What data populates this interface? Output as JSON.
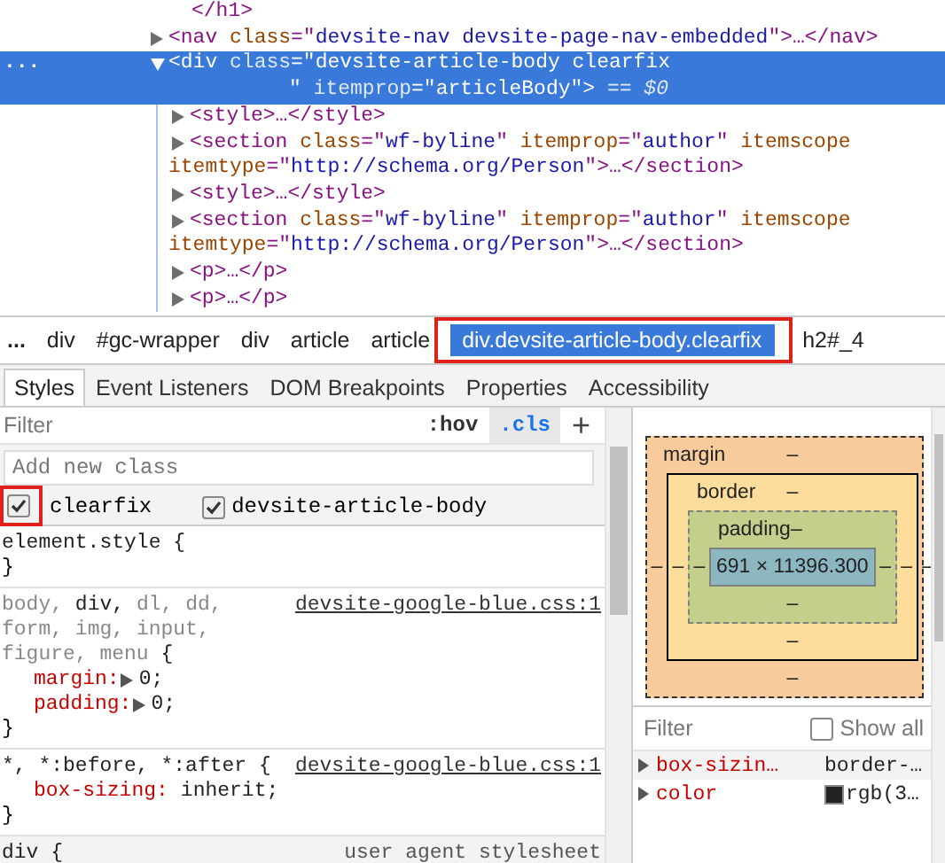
{
  "dom": {
    "nodes": [
      {
        "kind": "close",
        "lines": [
          [
            {
              "kind": "tag",
              "text": "</h1>"
            }
          ]
        ]
      },
      {
        "kind": "element",
        "expanded": false,
        "selected": false,
        "lines": [
          [
            {
              "kind": "tag",
              "text": "<nav"
            },
            {
              "kind": "attr",
              "text": " class"
            },
            {
              "kind": "tag",
              "text": "=\""
            },
            {
              "kind": "value",
              "text": "devsite-nav devsite-page-nav-embedded"
            },
            {
              "kind": "tag",
              "text": "\">…</nav>"
            }
          ]
        ]
      },
      {
        "kind": "element",
        "expanded": true,
        "selected": true,
        "gutter": "...",
        "lines": [
          [
            {
              "kind": "tag",
              "text": "<div"
            },
            {
              "kind": "attr",
              "text": " class"
            },
            {
              "kind": "tag",
              "text": "=\""
            },
            {
              "kind": "value",
              "text": "devsite-article-body clearfix"
            }
          ],
          [
            {
              "kind": "tag",
              "text": "\""
            },
            {
              "kind": "attr",
              "text": " itemprop"
            },
            {
              "kind": "tag",
              "text": "=\""
            },
            {
              "kind": "value",
              "text": "articleBody"
            },
            {
              "kind": "tag",
              "text": "\">"
            },
            {
              "kind": "ref",
              "text": " == $0"
            }
          ]
        ],
        "children": [
          {
            "kind": "element",
            "expanded": false,
            "selected": false,
            "lines": [
              [
                {
                  "kind": "tag",
                  "text": "<style>…</style>"
                }
              ]
            ]
          },
          {
            "kind": "element",
            "expanded": false,
            "selected": false,
            "lines": [
              [
                {
                  "kind": "tag",
                  "text": "<section"
                },
                {
                  "kind": "attr",
                  "text": " class"
                },
                {
                  "kind": "tag",
                  "text": "=\""
                },
                {
                  "kind": "value",
                  "text": "wf-byline"
                },
                {
                  "kind": "tag",
                  "text": "\""
                },
                {
                  "kind": "attr",
                  "text": " itemprop"
                },
                {
                  "kind": "tag",
                  "text": "=\""
                },
                {
                  "kind": "value",
                  "text": "author"
                },
                {
                  "kind": "tag",
                  "text": "\""
                },
                {
                  "kind": "attr",
                  "text": " itemscope"
                }
              ],
              [
                {
                  "kind": "attr",
                  "text": "itemtype"
                },
                {
                  "kind": "tag",
                  "text": "=\""
                },
                {
                  "kind": "value",
                  "text": "http://schema.org/Person"
                },
                {
                  "kind": "tag",
                  "text": "\">…</section>"
                }
              ]
            ]
          },
          {
            "kind": "element",
            "expanded": false,
            "selected": false,
            "lines": [
              [
                {
                  "kind": "tag",
                  "text": "<style>…</style>"
                }
              ]
            ]
          },
          {
            "kind": "element",
            "expanded": false,
            "selected": false,
            "lines": [
              [
                {
                  "kind": "tag",
                  "text": "<section"
                },
                {
                  "kind": "attr",
                  "text": " class"
                },
                {
                  "kind": "tag",
                  "text": "=\""
                },
                {
                  "kind": "value",
                  "text": "wf-byline"
                },
                {
                  "kind": "tag",
                  "text": "\""
                },
                {
                  "kind": "attr",
                  "text": " itemprop"
                },
                {
                  "kind": "tag",
                  "text": "=\""
                },
                {
                  "kind": "value",
                  "text": "author"
                },
                {
                  "kind": "tag",
                  "text": "\""
                },
                {
                  "kind": "attr",
                  "text": " itemscope"
                }
              ],
              [
                {
                  "kind": "attr",
                  "text": "itemtype"
                },
                {
                  "kind": "tag",
                  "text": "=\""
                },
                {
                  "kind": "value",
                  "text": "http://schema.org/Person"
                },
                {
                  "kind": "tag",
                  "text": "\">…</section>"
                }
              ]
            ]
          },
          {
            "kind": "element",
            "expanded": false,
            "selected": false,
            "lines": [
              [
                {
                  "kind": "tag",
                  "text": "<p>…</p>"
                }
              ]
            ]
          },
          {
            "kind": "element",
            "expanded": false,
            "selected": false,
            "lines": [
              [
                {
                  "kind": "tag",
                  "text": "<p>…</p>"
                }
              ]
            ]
          }
        ]
      }
    ]
  },
  "breadcrumbs": [
    {
      "text": "...",
      "kind": "more",
      "selected": false,
      "highlighted": false
    },
    {
      "text": "div",
      "kind": "crumb",
      "selected": false,
      "highlighted": false
    },
    {
      "text": "#gc-wrapper",
      "kind": "crumb",
      "selected": false,
      "highlighted": false
    },
    {
      "text": "div",
      "kind": "crumb",
      "selected": false,
      "highlighted": false
    },
    {
      "text": "article",
      "kind": "crumb",
      "selected": false,
      "highlighted": false
    },
    {
      "text": "article",
      "kind": "crumb",
      "selected": false,
      "highlighted": false
    },
    {
      "text": "div.devsite-article-body.clearfix",
      "kind": "crumb",
      "selected": true,
      "highlighted": true
    },
    {
      "text": "h2#_4",
      "kind": "crumb",
      "selected": false,
      "highlighted": false
    }
  ],
  "tabs": [
    {
      "label": "Styles",
      "selected": true
    },
    {
      "label": "Event Listeners",
      "selected": false
    },
    {
      "label": "DOM Breakpoints",
      "selected": false
    },
    {
      "label": "Properties",
      "selected": false
    },
    {
      "label": "Accessibility",
      "selected": false
    }
  ],
  "styles": {
    "filter": {
      "placeholder": "Filter"
    },
    "hov": {
      "text": ":hov",
      "on": false
    },
    "cls": {
      "text": ".cls",
      "on": true
    },
    "add": "+",
    "add_class": {
      "placeholder": "Add new class"
    },
    "classes": [
      {
        "name": "clearfix",
        "checked": true,
        "highlighted": true
      },
      {
        "name": "devsite-article-body",
        "checked": true,
        "highlighted": false
      }
    ],
    "rules": [
      {
        "kind": "inline",
        "selectors": [
          {
            "text": "element.style",
            "matched": true
          }
        ],
        "open": "{",
        "close": "}"
      },
      {
        "kind": "author",
        "selectors": [
          {
            "text": "body,",
            "matched": false
          },
          {
            "text": "div,",
            "matched": true
          },
          {
            "text": "dl,",
            "matched": false
          },
          {
            "text": "dd,",
            "matched": false
          },
          {
            "text": "form,",
            "matched": false
          },
          {
            "text": "img,",
            "matched": false
          },
          {
            "text": "input,",
            "matched": false
          },
          {
            "text": "figure,",
            "matched": false
          },
          {
            "text": "menu",
            "matched": false
          }
        ],
        "open": "{",
        "source": "devsite-google-blue.css:1",
        "props": [
          {
            "name": "margin:",
            "value": "0;",
            "expandable": true
          },
          {
            "name": "padding:",
            "value": "0;",
            "expandable": true
          }
        ],
        "close": "}"
      },
      {
        "kind": "author",
        "selectors": [
          {
            "text": "*,",
            "matched": true
          },
          {
            "text": "*:before,",
            "matched": true
          },
          {
            "text": "*:after",
            "matched": true
          }
        ],
        "open": "{",
        "source": "devsite-google-blue.css:1",
        "props": [
          {
            "name": "box-sizing:",
            "value": "inherit;",
            "expandable": false
          }
        ],
        "close": "}"
      },
      {
        "kind": "user-agent",
        "selectors": [
          {
            "text": "div",
            "matched": true
          }
        ],
        "open": "{",
        "source": "user agent stylesheet"
      }
    ]
  },
  "box_model": {
    "margin": {
      "label": "margin",
      "top": "–",
      "right": "–",
      "bottom": "–",
      "left": "–"
    },
    "border": {
      "label": "border",
      "top": "–",
      "right": "–",
      "bottom": "–",
      "left": "–"
    },
    "padding": {
      "label": "padding",
      "top": "–",
      "right": "–",
      "bottom": "–",
      "left": "–"
    },
    "content": "691 × 11396.300"
  },
  "computed": {
    "filter": {
      "placeholder": "Filter"
    },
    "show_all": {
      "label": "Show all",
      "checked": false
    },
    "props": [
      {
        "name": "box-sizin…",
        "value": "border-…"
      },
      {
        "name": "color",
        "value": "rgb(3…",
        "color": "#222222"
      }
    ]
  }
}
